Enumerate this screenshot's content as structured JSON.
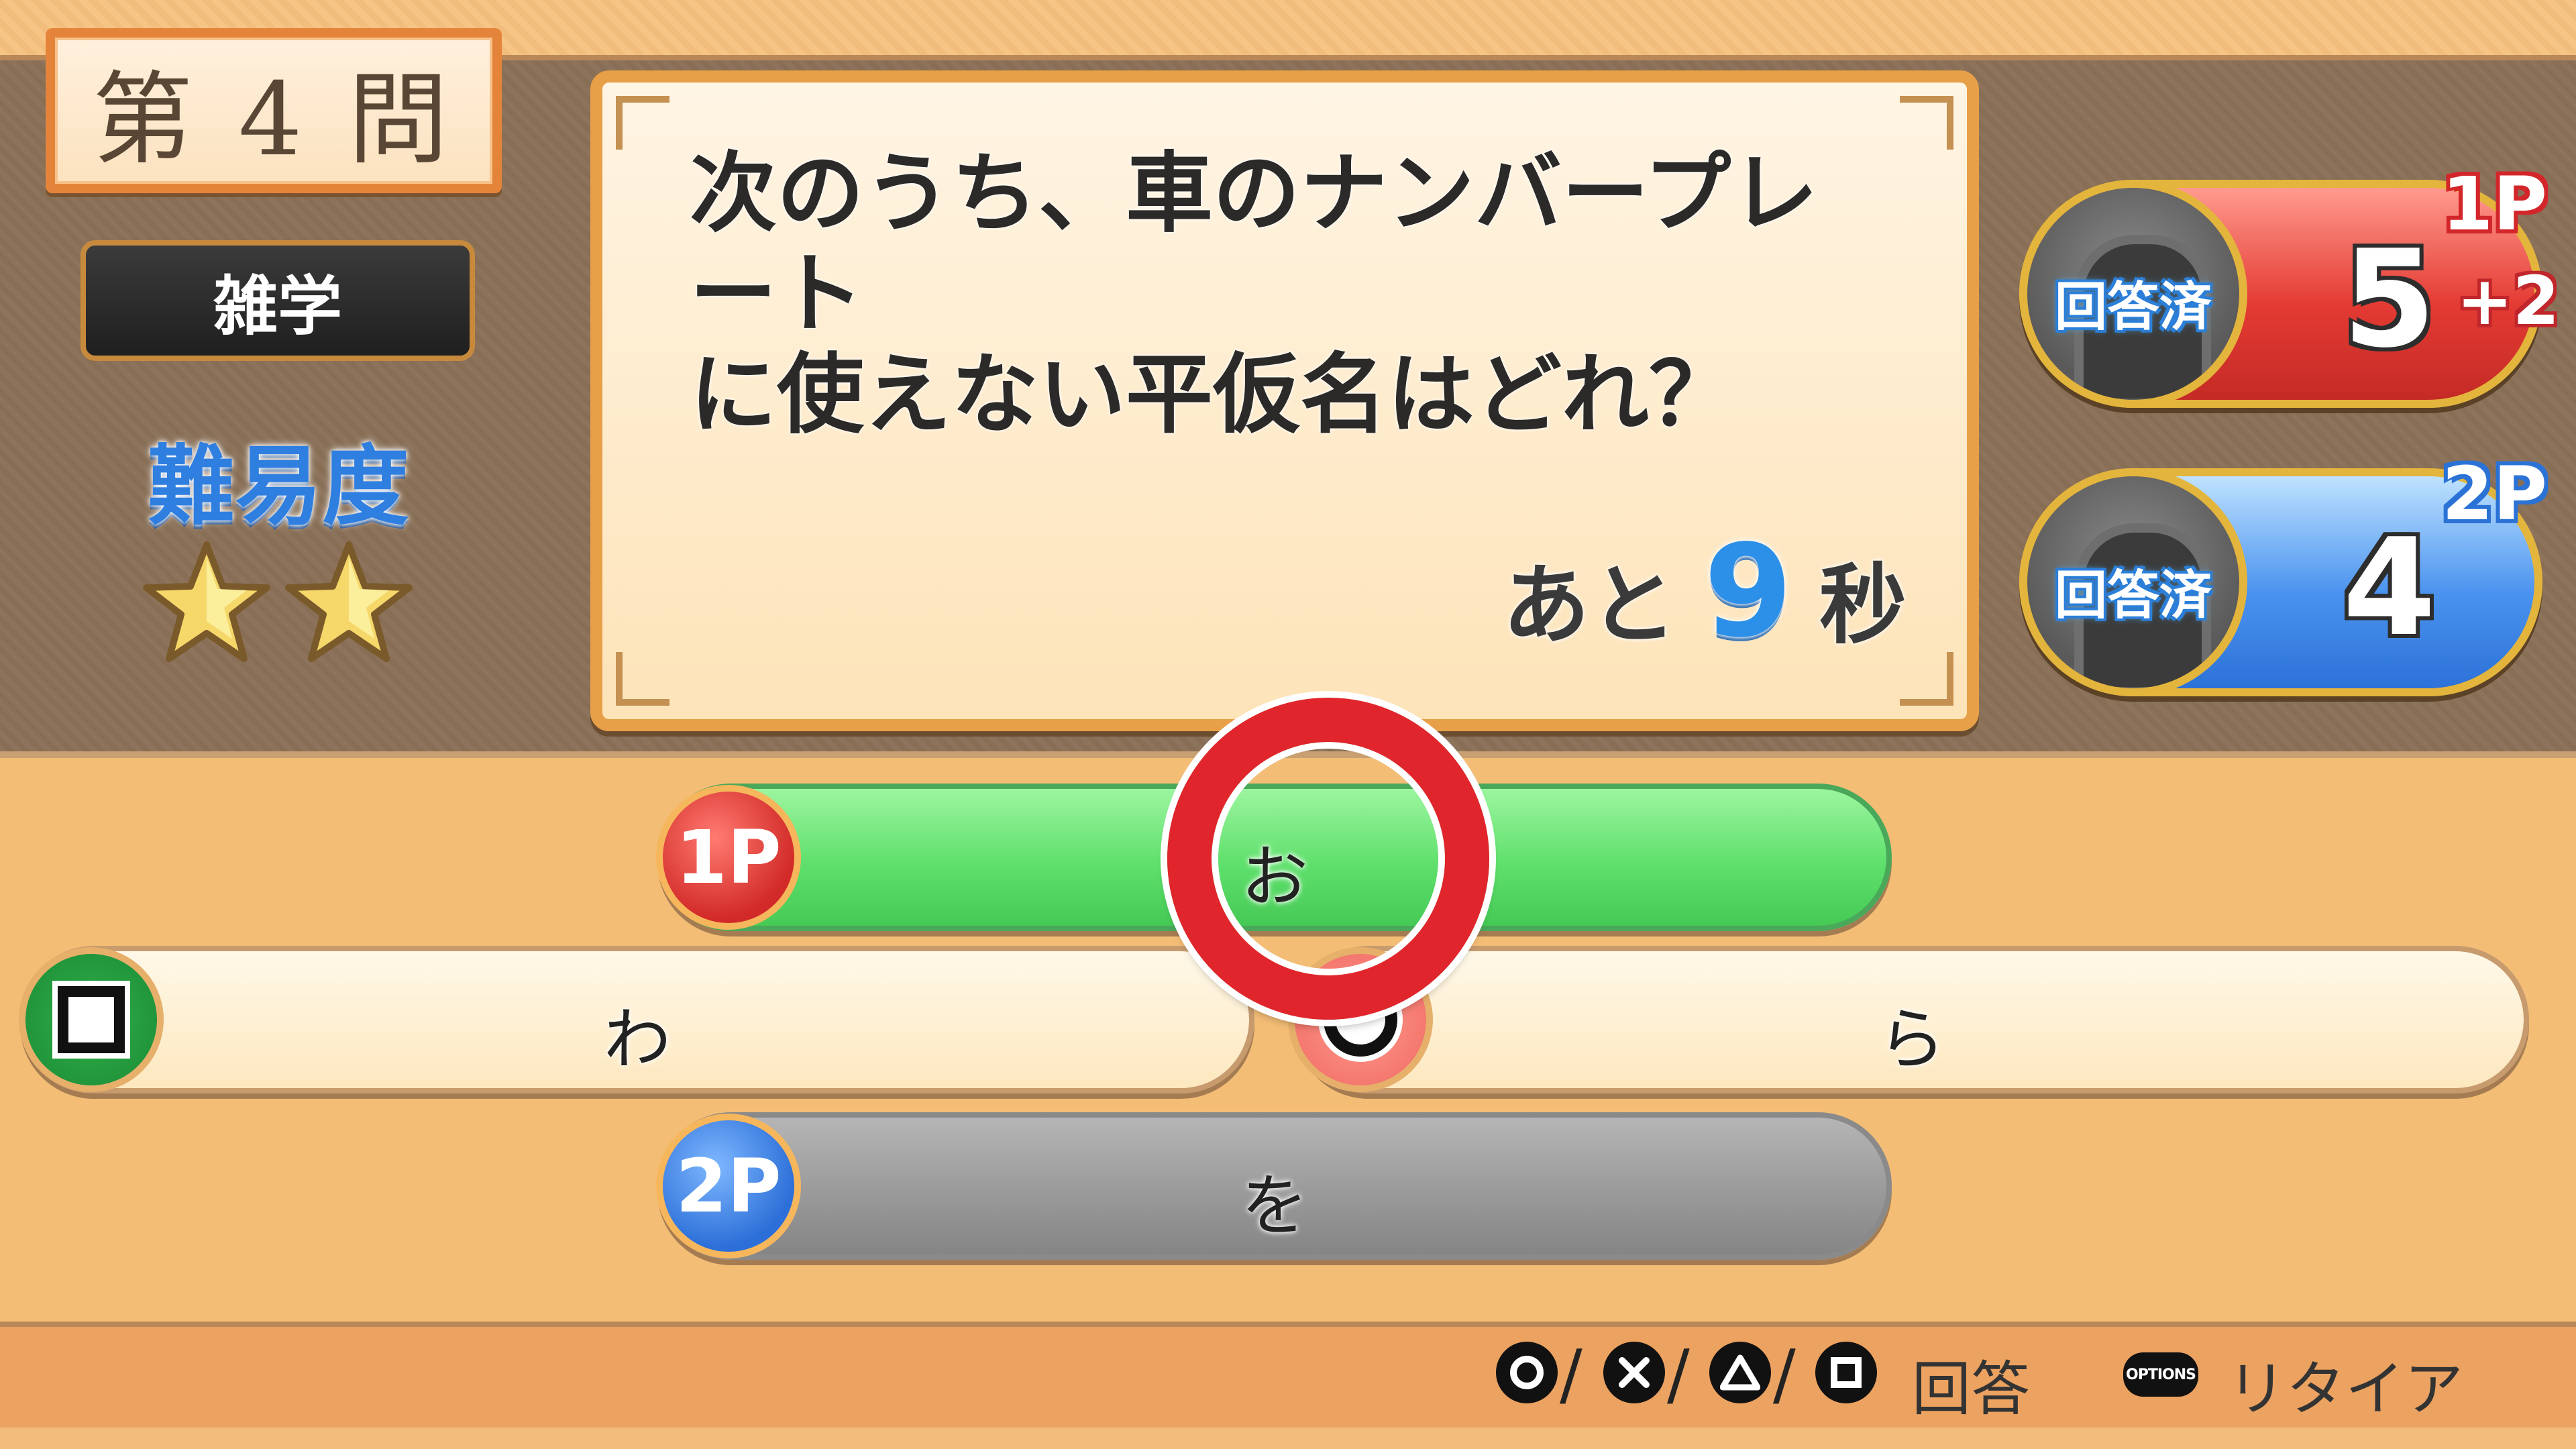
{
  "question_number": "第 4 問",
  "category": "雑学",
  "difficulty": {
    "label": "難易度",
    "stars": 2
  },
  "question": {
    "line1": "次のうち、車のナンバープレート",
    "line2": "に使えない平仮名はどれ？"
  },
  "timer": {
    "prefix": "あと",
    "seconds": "9",
    "suffix": "秒"
  },
  "players": [
    {
      "tag": "1P",
      "status": "回答済",
      "score": "5",
      "bonus": "+2",
      "color": "#e43b33"
    },
    {
      "tag": "2P",
      "status": "回答済",
      "score": "4",
      "bonus": "",
      "color": "#4a93ef"
    }
  ],
  "answers": {
    "top": {
      "badge": "1P",
      "text": "お",
      "button": "circle"
    },
    "left": {
      "text": "わ",
      "button": "square"
    },
    "right": {
      "text": "ら",
      "button": "circle"
    },
    "bottom": {
      "badge": "2P",
      "text": "を"
    }
  },
  "footer": {
    "answer_buttons": [
      "circle-button-icon",
      "cross-button-icon",
      "triangle-button-icon",
      "square-button-icon"
    ],
    "answer_label": "回答",
    "options_button": "OPTIONS",
    "retire_label": "リタイア"
  }
}
